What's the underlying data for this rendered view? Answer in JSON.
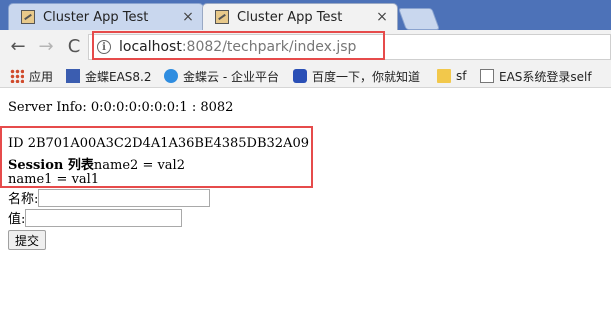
{
  "tabs": [
    {
      "title": "Cluster App Test",
      "close": "×",
      "active": false
    },
    {
      "title": "Cluster App Test",
      "close": "×",
      "active": true
    }
  ],
  "toolbar": {
    "back": "←",
    "forward": "→",
    "reload": "C",
    "info_icon": "i",
    "url_host": "localhost",
    "url_path": ":8082/techpark/index.jsp"
  },
  "bookmarks": [
    {
      "label": "应用",
      "icon": "apps-grid-icon"
    },
    {
      "label": "金蝶EAS8.2",
      "icon": "eas-icon"
    },
    {
      "label": "金蝶云 - 企业平台",
      "icon": "cloud-icon"
    },
    {
      "label": "百度一下，你就知道",
      "icon": "baidu-paw-icon"
    },
    {
      "label": "sf",
      "icon": "folder-icon"
    },
    {
      "label": "EAS系统登录self",
      "icon": "page-icon"
    }
  ],
  "page": {
    "server_info": "Server Info: 0:0:0:0:0:0:0:1 : 8082",
    "session_id": "ID 2B701A00A3C2D4A1A36BE4385DB32A09",
    "session_list_label": "Session 列表",
    "session_list_first": "name2 = val2",
    "session_list_second": "name1 = val1",
    "name_label": "名称:",
    "value_label": "值:",
    "name_value": "",
    "value_value": "",
    "submit_label": "提交"
  },
  "colors": {
    "tabstrip": "#4d72b8",
    "highlight": "#e64b4b"
  }
}
